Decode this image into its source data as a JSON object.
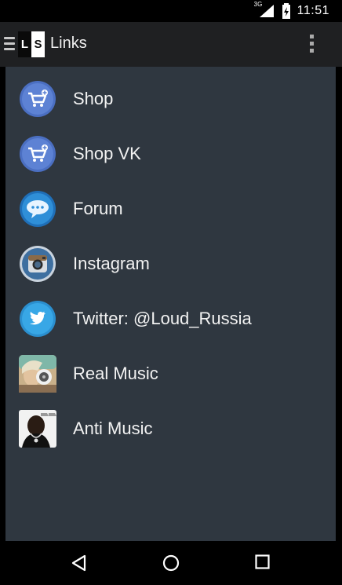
{
  "status_bar": {
    "network": "3G",
    "time": "11:51"
  },
  "action_bar": {
    "logo_letters": [
      "L",
      "S"
    ],
    "title": "Links"
  },
  "links": [
    {
      "label": "Shop",
      "icon": "shopping-cart-icon"
    },
    {
      "label": "Shop VK",
      "icon": "shopping-cart-icon"
    },
    {
      "label": "Forum",
      "icon": "chat-bubble-icon"
    },
    {
      "label": "Instagram",
      "icon": "instagram-icon"
    },
    {
      "label": "Twitter: @Loud_Russia",
      "icon": "twitter-icon"
    },
    {
      "label": "Real Music",
      "icon": "real-music-thumbnail"
    },
    {
      "label": "Anti Music",
      "icon": "anti-music-thumbnail"
    }
  ],
  "colors": {
    "actionbar": "#1f2022",
    "content_bg": "#2f3740",
    "shop_icon": "#4b6fc2",
    "forum_icon": "#2f8fd8",
    "instagram_icon": "#3e6fa0",
    "twitter_icon": "#38a7e6"
  }
}
